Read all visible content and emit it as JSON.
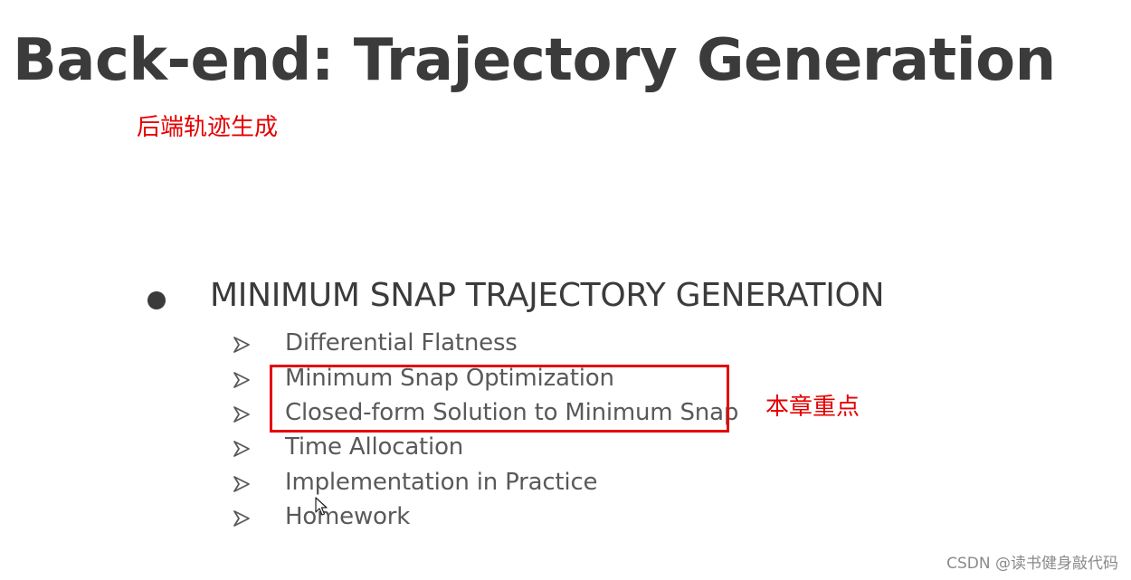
{
  "slide": {
    "title": "Back-end: Trajectory Generation",
    "subtitle_cn": "后端轨迹生成",
    "main_bullet": "MINIMUM SNAP TRAJECTORY GENERATION",
    "sub_items": [
      "Differential Flatness",
      "Minimum Snap Optimization",
      "Closed-form Solution to Minimum Snap",
      "Time Allocation",
      "Implementation in Practice",
      "Homework"
    ],
    "highlight_label_cn": "本章重点",
    "icons": {
      "bullet": "filled-circle-bullet-icon",
      "sub_bullet": "arrowhead-bullet-icon",
      "pointer": "mouse-cursor-icon"
    }
  },
  "watermark": "CSDN @读书健身敲代码",
  "colors": {
    "title": "#3b3b3b",
    "sub_text": "#595959",
    "annotation": "#e60000",
    "watermark": "#8a8a8a",
    "background": "#ffffff"
  }
}
